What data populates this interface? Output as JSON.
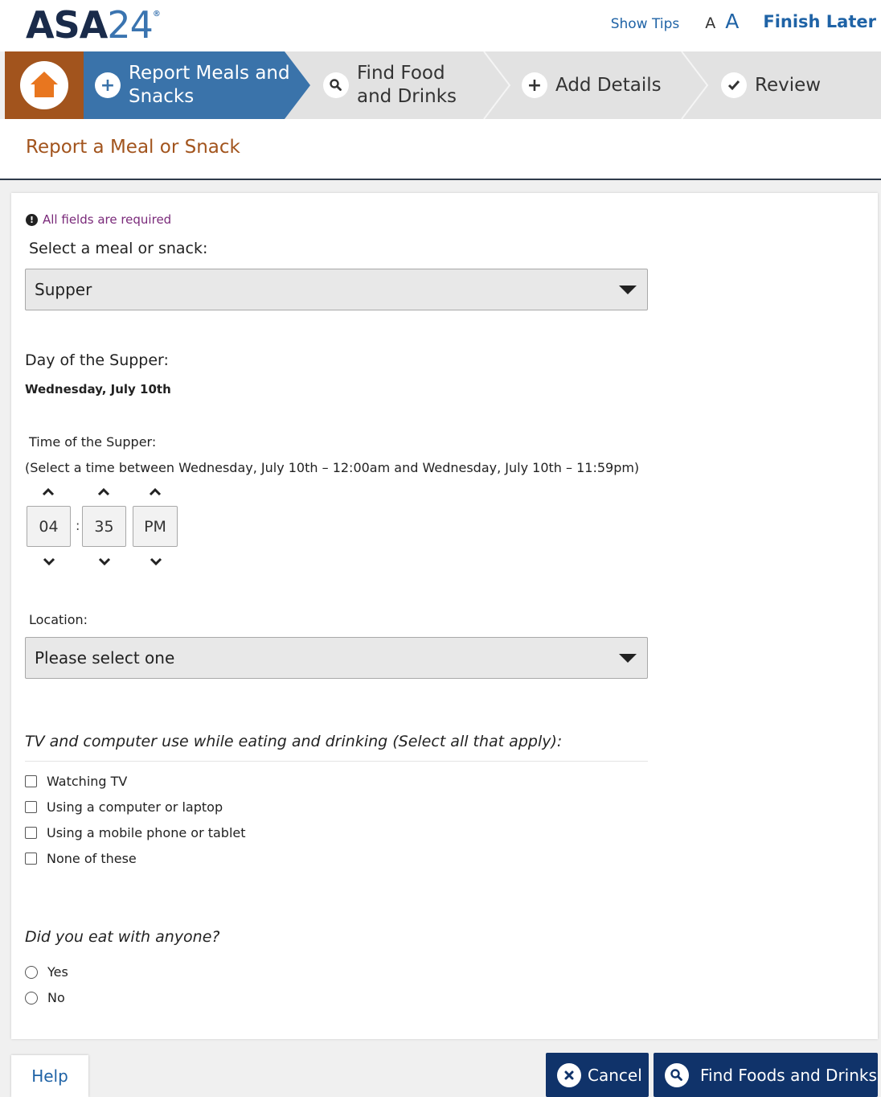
{
  "header": {
    "logo_text": "ASA",
    "logo_number": "24",
    "logo_mark": "®",
    "show_tips": "Show Tips",
    "font_small": "A",
    "font_large": "A",
    "finish_later": "Finish Later"
  },
  "steps": [
    {
      "label_line1": "Report Meals and",
      "label_line2": "Snacks",
      "icon": "plus-icon",
      "active": true
    },
    {
      "label_line1": "Find Food",
      "label_line2": "and Drinks",
      "icon": "search-icon",
      "active": false
    },
    {
      "label_line1": "Add Details",
      "label_line2": "",
      "icon": "plus-icon",
      "active": false
    },
    {
      "label_line1": "Review",
      "label_line2": "",
      "icon": "check-icon",
      "active": false
    }
  ],
  "page": {
    "title": "Report a Meal or Snack"
  },
  "form": {
    "required_note": "All fields are required",
    "meal_label": "Select a meal or snack:",
    "meal_value": "Supper",
    "day_label": "Day of the Supper:",
    "day_value": "Wednesday, July 10th",
    "time_label": "Time of the Supper:",
    "time_hint": "(Select a time between Wednesday, July 10th – 12:00am and Wednesday, July 10th – 11:59pm)",
    "time_hour": "04",
    "time_separator": ":",
    "time_minute": "35",
    "time_ampm": "PM",
    "location_label": "Location:",
    "location_value": "Please select one",
    "screen_question": "TV and computer use while eating and drinking (Select all that apply):",
    "screen_options": [
      "Watching TV",
      "Using a computer or laptop",
      "Using a mobile phone or tablet",
      "None of these"
    ],
    "company_question": "Did you eat with anyone?",
    "company_options": [
      "Yes",
      "No"
    ]
  },
  "footer": {
    "help": "Help",
    "cancel": "Cancel",
    "find": "Find Foods and Drinks"
  },
  "colors": {
    "brand_navy": "#1a2b4a",
    "link_blue": "#1f63a6",
    "active_step": "#3a73aa",
    "home_brown": "#a2541d",
    "title_orange": "#a2541d",
    "button_navy": "#10336a"
  }
}
